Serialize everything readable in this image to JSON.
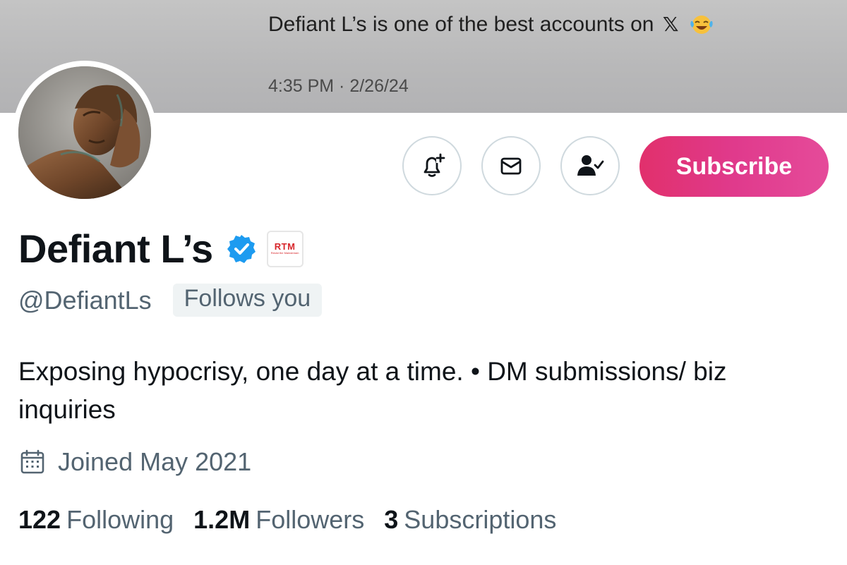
{
  "banner": {
    "tweet_text": "Defiant L’s is one of the best accounts on",
    "x_logo": "𝕏",
    "emoji": "laughing-tears-emoji",
    "timestamp": "4:35 PM · 2/26/24"
  },
  "actions": {
    "notify_icon": "bell-plus-icon",
    "message_icon": "envelope-icon",
    "following_icon": "person-check-icon",
    "subscribe_label": "Subscribe"
  },
  "profile": {
    "display_name": "Defiant L’s",
    "verified_icon": "verified-badge-icon",
    "affiliate_badge": "RTM",
    "affiliate_badge_sub": "Resist the Mainstream",
    "handle": "@DefiantLs",
    "follows_you": "Follows you",
    "bio": "Exposing hypocrisy, one day at a time. • DM submissions/ biz inquiries",
    "joined": "Joined May 2021"
  },
  "stats": {
    "following_count": "122",
    "following_label": "Following",
    "followers_count": "1.2M",
    "followers_label": "Followers",
    "subscriptions_count": "3",
    "subscriptions_label": "Subscriptions"
  },
  "colors": {
    "accent_blue": "#1d9bf0",
    "subscribe_pink": "#e1306c",
    "secondary_text": "#536471",
    "border": "#cfd9de"
  }
}
